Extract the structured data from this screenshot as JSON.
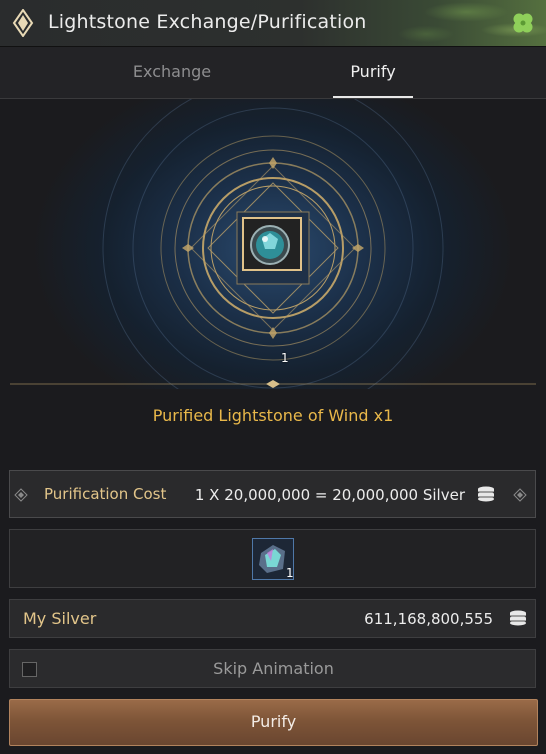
{
  "window": {
    "title": "Lightstone Exchange/Purification",
    "title_icon": "diamond-icon",
    "corner_icon": "clover-icon"
  },
  "tabs": [
    {
      "label": "Exchange",
      "active": false
    },
    {
      "label": "Purify",
      "active": true
    }
  ],
  "stage": {
    "item_icon": "lightstone-gem-icon",
    "item_quantity": "1",
    "result_text": "Purified Lightstone of Wind x1"
  },
  "cost": {
    "label": "Purification Cost",
    "formula": "1 X 20,000,000 = 20,000,000 Silver",
    "icon": "silver-coins-icon"
  },
  "material": {
    "icon": "crystal-material-icon",
    "quantity": "1"
  },
  "silver": {
    "label": "My Silver",
    "value": "611,168,800,555",
    "icon": "silver-coins-icon"
  },
  "skip_animation": {
    "label": "Skip Animation",
    "checked": false
  },
  "actions": {
    "purify_label": "Purify"
  },
  "colors": {
    "accent_gold": "#e9b84a",
    "label_gold": "#e2c58a",
    "button_brown": "#7e5538"
  }
}
